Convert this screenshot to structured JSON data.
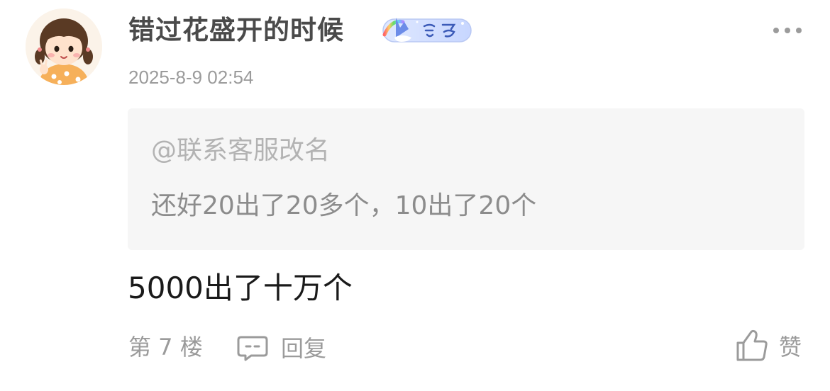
{
  "comment": {
    "username": "错过花盛开的时候",
    "timestamp": "2025-8-9 02:54",
    "badge_icon": "member-badge-icon",
    "quote": {
      "mention": "@联系客服改名",
      "text": "还好20出了20多个，10出了20个"
    },
    "text": "5000出了十万个",
    "floor": "第 7 楼",
    "reply_label": "回复",
    "like_label": "赞"
  },
  "colors": {
    "username": "#4a4a4a",
    "meta": "#9b9b9b",
    "quote_bg": "#f6f6f6",
    "body_text": "#1a1a1a"
  }
}
